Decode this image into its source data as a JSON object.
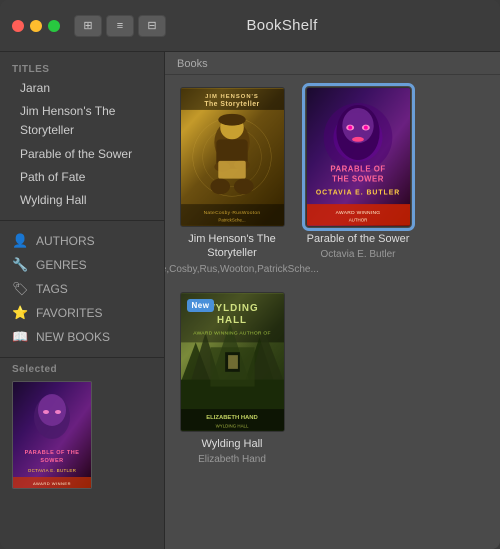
{
  "window": {
    "title": "BookShelf"
  },
  "toolbar": {
    "btn1_label": "⊞",
    "btn2_label": "≡",
    "btn3_label": "⊟"
  },
  "sidebar": {
    "titles_header": "TITLES",
    "titles": [
      {
        "label": "Jaran"
      },
      {
        "label": "Jim Henson's The Storyteller"
      },
      {
        "label": "Parable of the Sower"
      },
      {
        "label": "Path of Fate"
      },
      {
        "label": "Wylding Hall"
      }
    ],
    "nav_items": [
      {
        "label": "AUTHORS",
        "icon": "👤"
      },
      {
        "label": "GENRES",
        "icon": "🔧"
      },
      {
        "label": "TAGS",
        "icon": "🏷"
      },
      {
        "label": "FAVORITES",
        "icon": "⭐"
      },
      {
        "label": "NEW BOOKS",
        "icon": "📖"
      }
    ],
    "selected_label": "Selected"
  },
  "books_area": {
    "header": "Books",
    "books": [
      {
        "id": "storyteller",
        "title": "Jim Henson's The Storyteller",
        "author": "Nate,Cosby,Rus,Wooton,PatrickSche...",
        "selected": false
      },
      {
        "id": "sower",
        "title": "Parable of the Sower",
        "author": "Octavia E. Butler",
        "selected": true
      },
      {
        "id": "wylding",
        "title": "Wylding Hall",
        "author": "Elizabeth Hand",
        "selected": false,
        "badge": "New"
      }
    ]
  }
}
